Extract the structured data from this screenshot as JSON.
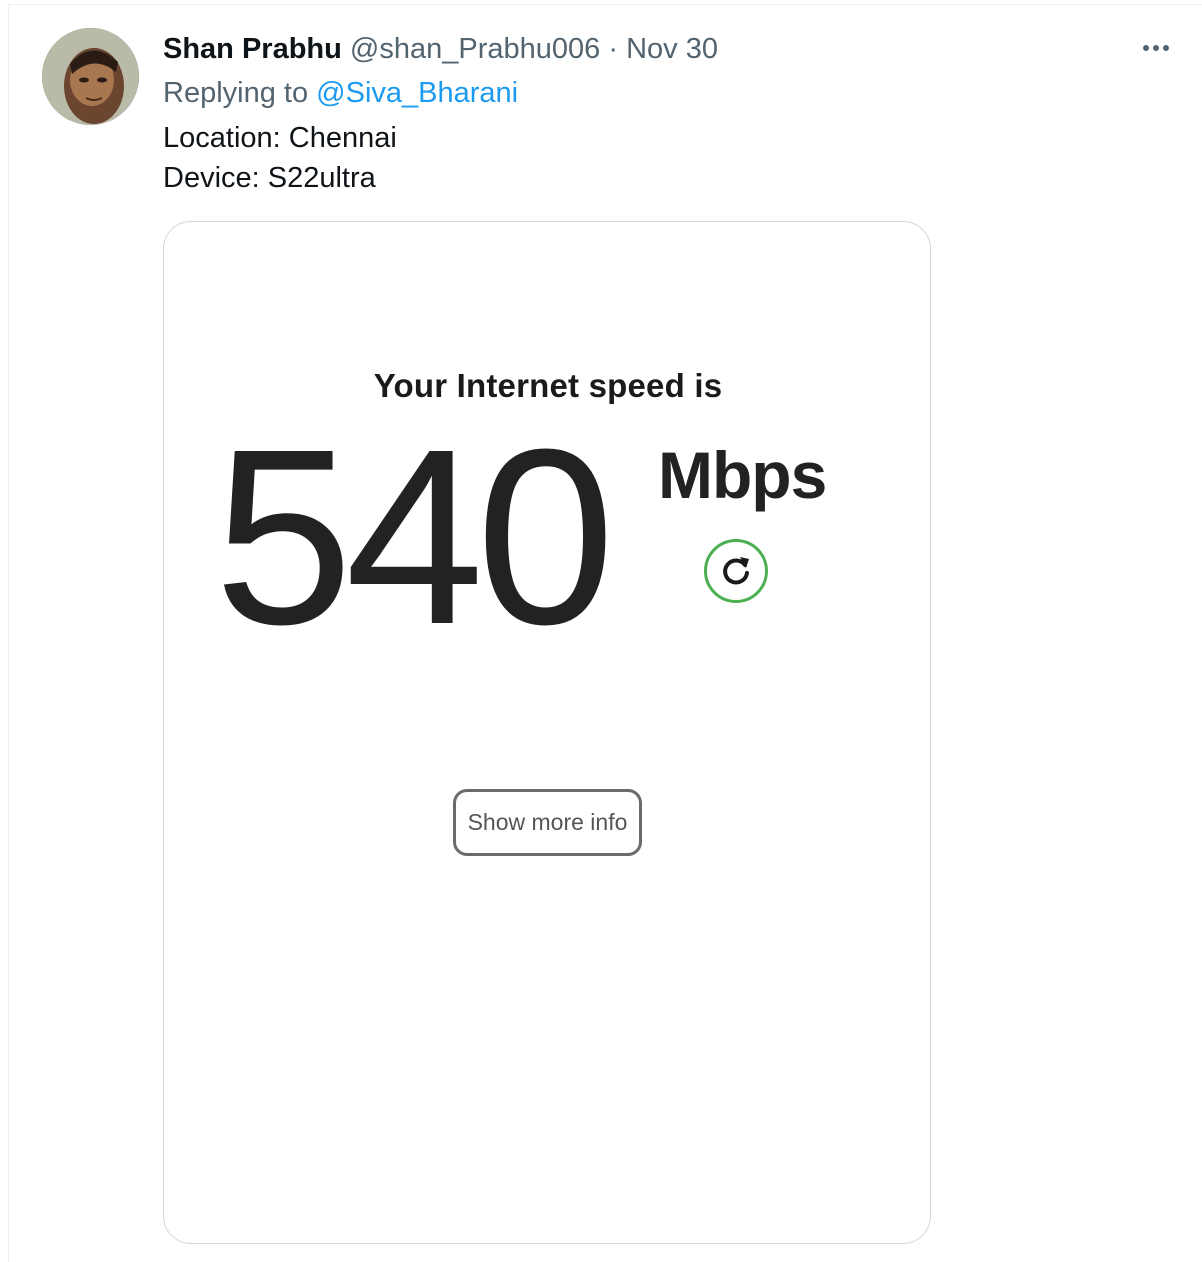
{
  "tweet": {
    "display_name": "Shan Prabhu",
    "handle": "@shan_Prabhu006",
    "separator": "·",
    "date": "Nov 30",
    "reply_prefix": "Replying to",
    "reply_to": "@Siva_Bharani",
    "lines": [
      "Location: Chennai",
      "Device: S22ultra"
    ],
    "more_icon": "more-dots-icon"
  },
  "speedtest": {
    "heading": "Your Internet speed is",
    "value": "540",
    "unit": "Mbps",
    "refresh_icon": "refresh-icon",
    "more_info_label": "Show more info"
  },
  "colors": {
    "link": "#1d9bf0",
    "secondary_text": "#536471",
    "refresh_ring": "#4caf50"
  }
}
